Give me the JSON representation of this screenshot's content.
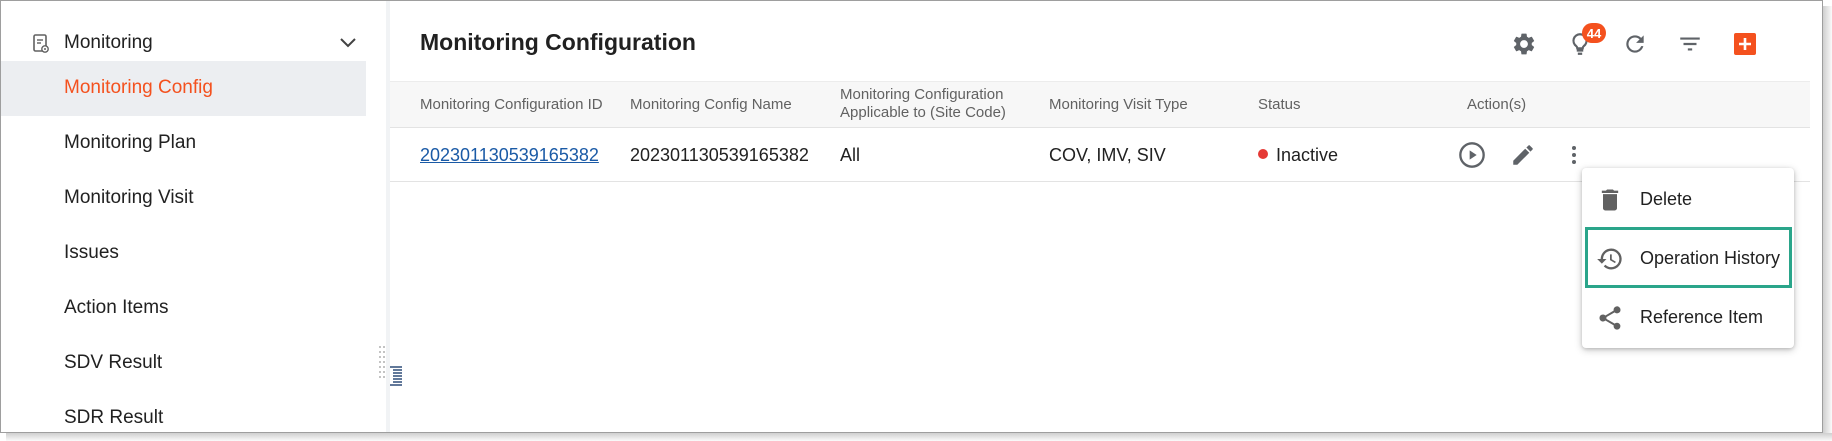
{
  "sidebar": {
    "section_label": "Monitoring",
    "items": [
      {
        "label": "Monitoring Config"
      },
      {
        "label": "Monitoring Plan"
      },
      {
        "label": "Monitoring Visit"
      },
      {
        "label": "Issues"
      },
      {
        "label": "Action Items"
      },
      {
        "label": "SDV Result"
      },
      {
        "label": "SDR Result"
      }
    ],
    "active_index": 0
  },
  "header": {
    "title": "Monitoring Configuration",
    "notification_count": "44",
    "icons": [
      "gear-icon",
      "lightbulb-icon",
      "refresh-icon",
      "filter-icon",
      "add-icon"
    ]
  },
  "table": {
    "columns": [
      "Monitoring Configuration ID",
      "Monitoring Config Name",
      "Monitoring Configuration\nApplicable to (Site Code)",
      "Monitoring Visit Type",
      "Status",
      "Action(s)"
    ],
    "rows": [
      {
        "id": "202301130539165382",
        "name": "202301130539165382",
        "applicable": "All",
        "visit_type": "COV, IMV, SIV",
        "status": "Inactive"
      }
    ]
  },
  "menu": {
    "items": [
      {
        "label": "Delete",
        "icon": "trash-icon"
      },
      {
        "label": "Operation History",
        "icon": "history-icon"
      },
      {
        "label": "Reference Item",
        "icon": "share-icon"
      }
    ]
  },
  "colors": {
    "accent": "#f4511e",
    "link": "#1a5aa6",
    "status_inactive": "#e53935",
    "highlight": "#2aa58a",
    "active_bg": "#eceef1"
  }
}
